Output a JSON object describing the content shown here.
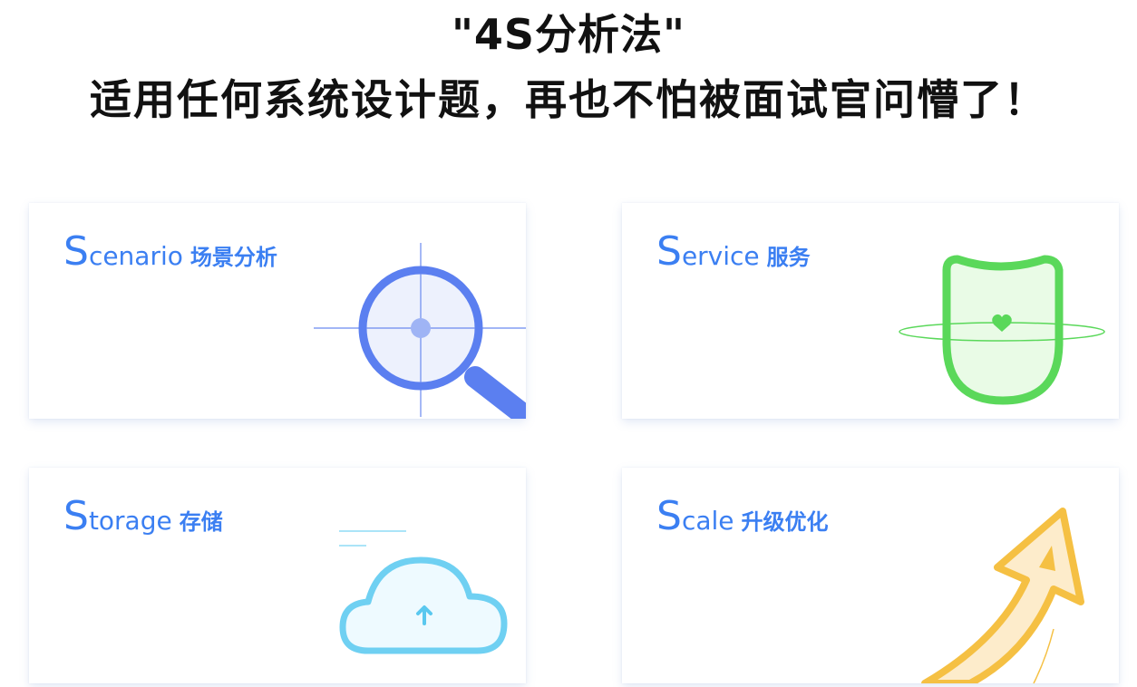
{
  "header": {
    "line1": "\"4S分析法\"",
    "line2": "适用任何系统设计题，再也不怕被面试官问懵了！"
  },
  "cards": [
    {
      "initial": "S",
      "rest": "cenario",
      "zh": "场景分析",
      "icon": "magnifier-icon",
      "accent": "#5b7ff0"
    },
    {
      "initial": "S",
      "rest": "ervice",
      "zh": "服务",
      "icon": "shield-heart-icon",
      "accent": "#5ad85a"
    },
    {
      "initial": "S",
      "rest": "torage",
      "zh": "存储",
      "icon": "cloud-upload-icon",
      "accent": "#6fd0f2"
    },
    {
      "initial": "S",
      "rest": "cale",
      "zh": "升级优化",
      "icon": "arrow-up-icon",
      "accent": "#f5c043"
    }
  ],
  "colors": {
    "title_text": "#3b7ff2",
    "heading": "#111111"
  }
}
